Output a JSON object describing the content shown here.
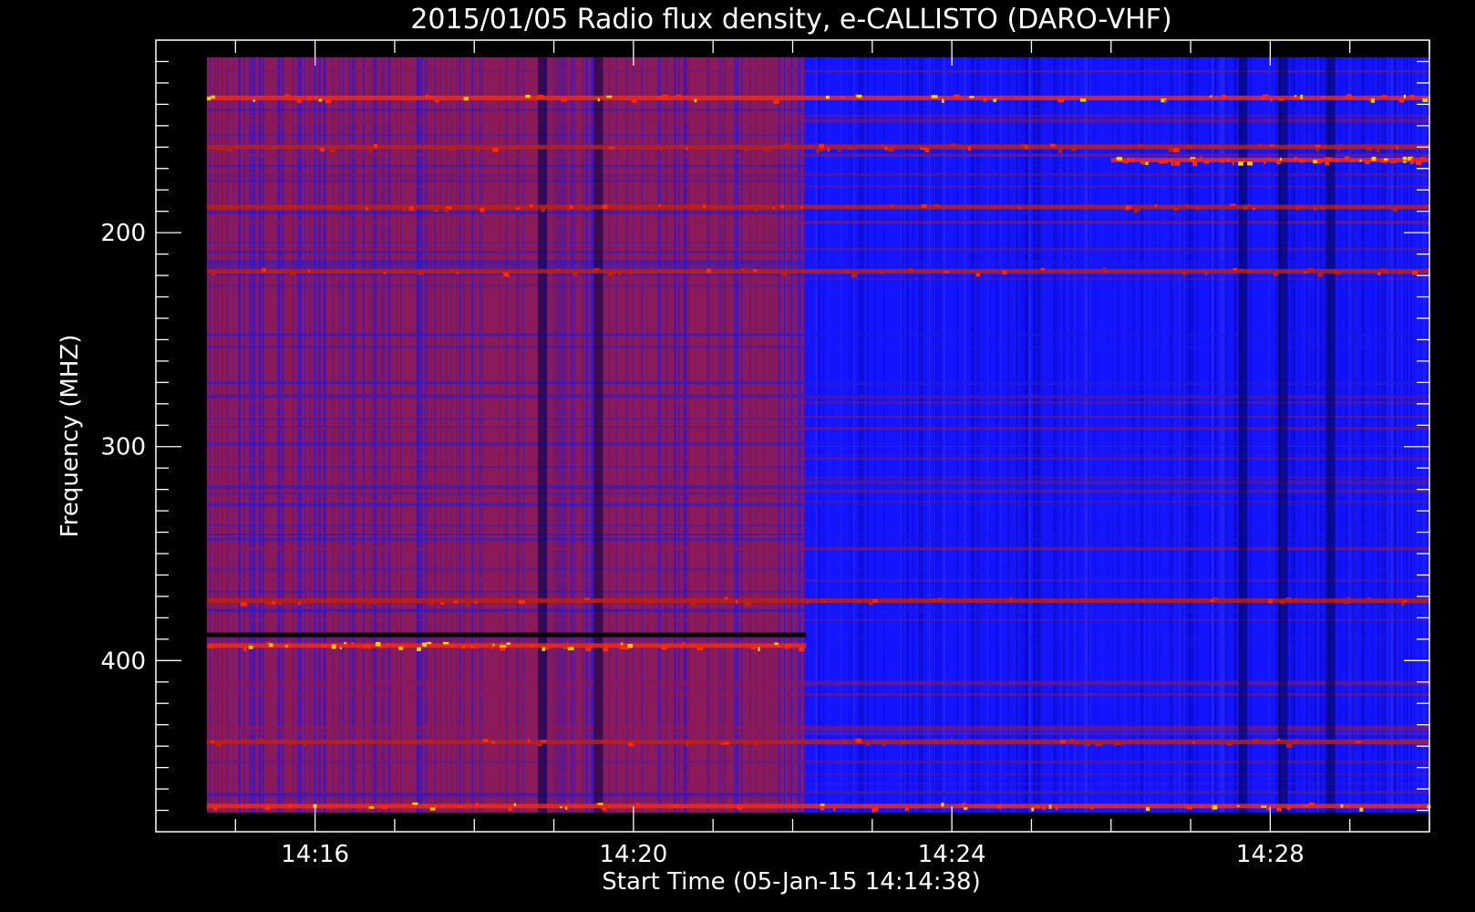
{
  "chart_data": {
    "type": "heatmap",
    "title": "2015/01/05  Radio flux density, e-CALLISTO (DARO-VHF)",
    "xlabel": "Start Time (05-Jan-15 14:14:38)",
    "ylabel": "Frequency (MHZ)",
    "x_ticks": [
      "14:16",
      "14:20",
      "14:24",
      "14:28"
    ],
    "y_ticks": [
      "200",
      "300",
      "400"
    ],
    "x_range_minutes_after_1400": [
      14.0,
      30.0
    ],
    "data_range_minutes_after_1400": [
      14.64,
      30.0
    ],
    "y_range_mhz": [
      110,
      480
    ],
    "data_y_range_mhz": [
      118,
      471
    ],
    "y_axis_inverted": true,
    "background_change_minute": 22.17,
    "colormap": [
      "#000000",
      "#1414ff",
      "#8a1a5a",
      "#ff2a00",
      "#ffd200"
    ],
    "features": [
      {
        "kind": "band",
        "freq": 137,
        "start": 14.64,
        "end": 30.0,
        "intensity": "hot"
      },
      {
        "kind": "band",
        "freq": 160,
        "start": 14.64,
        "end": 30.0,
        "intensity": "warm"
      },
      {
        "kind": "band",
        "freq": 166,
        "start": 26.0,
        "end": 30.0,
        "intensity": "hot"
      },
      {
        "kind": "band",
        "freq": 188,
        "start": 14.64,
        "end": 30.0,
        "intensity": "warm"
      },
      {
        "kind": "band",
        "freq": 218,
        "start": 14.64,
        "end": 30.0,
        "intensity": "warm"
      },
      {
        "kind": "band",
        "freq": 372,
        "start": 14.64,
        "end": 30.0,
        "intensity": "warm"
      },
      {
        "kind": "band",
        "freq": 388,
        "start": 14.64,
        "end": 22.17,
        "intensity": "dark"
      },
      {
        "kind": "band",
        "freq": 393,
        "start": 14.64,
        "end": 22.17,
        "intensity": "hot"
      },
      {
        "kind": "band",
        "freq": 438,
        "start": 14.64,
        "end": 30.0,
        "intensity": "warm"
      },
      {
        "kind": "band",
        "freq": 468,
        "start": 14.64,
        "end": 30.0,
        "intensity": "hot"
      }
    ],
    "dark_columns": [
      18.8,
      19.5,
      27.6,
      28.1,
      28.7
    ],
    "grid": false
  }
}
